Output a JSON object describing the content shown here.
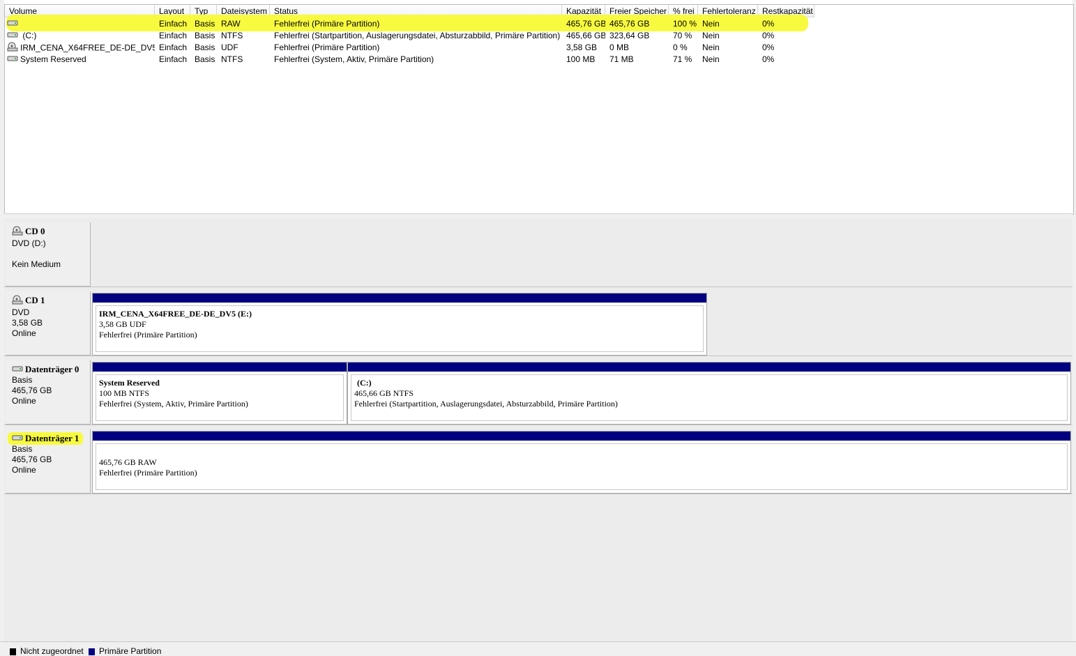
{
  "volume_table": {
    "columns": [
      "Volume",
      "Layout",
      "Typ",
      "Dateisystem",
      "Status",
      "Kapazität",
      "Freier Speicher",
      "% frei",
      "Fehlertoleranz",
      "Restkapazität"
    ],
    "rows": [
      {
        "volume": "",
        "icon": "hard-disk-icon",
        "layout": "Einfach",
        "typ": "Basis",
        "dateisystem": "RAW",
        "status": "Fehlerfrei (Primäre Partition)",
        "kapazitaet": "465,76 GB",
        "frei": "465,76 GB",
        "prozent": "100 %",
        "fehlertoleranz": "Nein",
        "rest": "0%",
        "highlighted": true
      },
      {
        "volume": " (C:)",
        "icon": "hard-disk-icon",
        "layout": "Einfach",
        "typ": "Basis",
        "dateisystem": "NTFS",
        "status": "Fehlerfrei (Startpartition, Auslagerungsdatei, Absturzabbild, Primäre Partition)",
        "kapazitaet": "465,66 GB",
        "frei": "323,64 GB",
        "prozent": "70 %",
        "fehlertoleranz": "Nein",
        "rest": "0%",
        "highlighted": false
      },
      {
        "volume": "IRM_CENA_X64FREE_DE-DE_DV5 (E:)",
        "icon": "dvd-drive-icon",
        "layout": "Einfach",
        "typ": "Basis",
        "dateisystem": "UDF",
        "status": "Fehlerfrei (Primäre Partition)",
        "kapazitaet": "3,58 GB",
        "frei": "0 MB",
        "prozent": "0 %",
        "fehlertoleranz": "Nein",
        "rest": "0%",
        "highlighted": false
      },
      {
        "volume": "System Reserved",
        "icon": "hard-disk-icon",
        "layout": "Einfach",
        "typ": "Basis",
        "dateisystem": "NTFS",
        "status": "Fehlerfrei (System, Aktiv, Primäre Partition)",
        "kapazitaet": "100 MB",
        "frei": "71 MB",
        "prozent": "71 %",
        "fehlertoleranz": "Nein",
        "rest": "0%",
        "highlighted": false
      }
    ]
  },
  "disks": [
    {
      "name": "CD 0",
      "icon": "cd-drive-icon",
      "lines": [
        "DVD (D:)",
        "",
        "Kein Medium"
      ],
      "partitions": []
    },
    {
      "name": "CD 1",
      "icon": "cd-drive-icon",
      "lines": [
        "DVD",
        "3,58 GB",
        "Online"
      ],
      "partitions": [
        {
          "title": "IRM_CENA_X64FREE_DE-DE_DV5  (E:)",
          "size": "3,58 GB UDF",
          "status": "Fehlerfrei (Primäre Partition)"
        }
      ]
    },
    {
      "name": "Datenträger 0",
      "icon": "hard-disk-icon",
      "lines": [
        "Basis",
        "465,76 GB",
        "Online"
      ],
      "partitions": [
        {
          "title": "System Reserved",
          "size": "100 MB NTFS",
          "status": "Fehlerfrei (System, Aktiv, Primäre Partition)"
        },
        {
          "title": " (C:)",
          "size": "465,66 GB NTFS",
          "status": "Fehlerfrei (Startpartition, Auslagerungsdatei, Absturzabbild, Primäre Partition)"
        }
      ]
    },
    {
      "name": "Datenträger 1",
      "icon": "hard-disk-icon",
      "lines": [
        "Basis",
        "465,76 GB",
        "Online"
      ],
      "highlighted": true,
      "partitions": [
        {
          "title": "",
          "size": "465,76 GB RAW",
          "status": "Fehlerfrei (Primäre Partition)"
        }
      ]
    }
  ],
  "legend": [
    {
      "label": "Nicht zugeordnet",
      "color": "#000000"
    },
    {
      "label": "Primäre Partition",
      "color": "#000080"
    }
  ],
  "colors": {
    "primary_partition": "#000080",
    "highlight": "#f8fa3f"
  }
}
